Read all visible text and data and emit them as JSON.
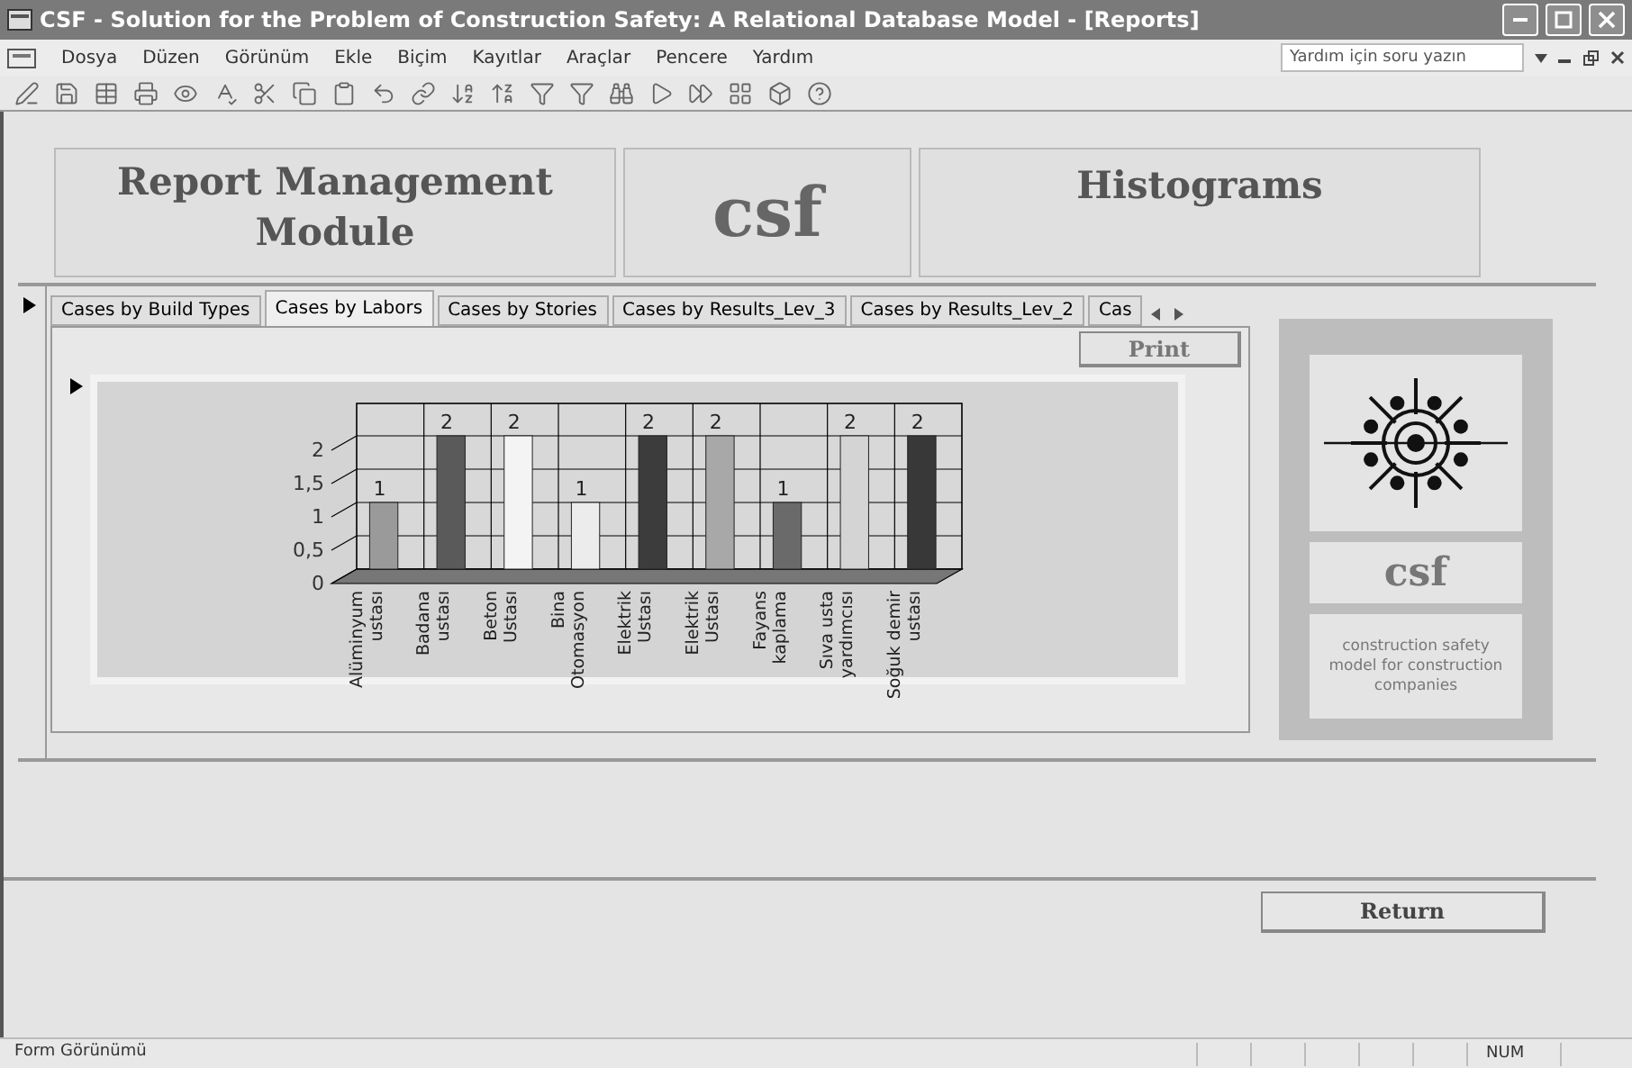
{
  "window": {
    "title": "CSF - Solution for the Problem of Construction Safety: A Relational Database Model - [Reports]"
  },
  "menu": [
    "Dosya",
    "Düzen",
    "Görünüm",
    "Ekle",
    "Biçim",
    "Kayıtlar",
    "Araçlar",
    "Pencere",
    "Yardım"
  ],
  "help_search": {
    "placeholder": "Yardım için soru yazın"
  },
  "header": {
    "module_title": "Report Management Module",
    "logo_text": "csf",
    "section_title": "Histograms"
  },
  "tabs": [
    {
      "label": "Cases by Build Types",
      "selected": false
    },
    {
      "label": "Cases by Labors",
      "selected": true
    },
    {
      "label": "Cases by Stories",
      "selected": false
    },
    {
      "label": "Cases by Results_Lev_3",
      "selected": false
    },
    {
      "label": "Cases by Results_Lev_2",
      "selected": false
    },
    {
      "label": "Cas",
      "selected": false
    }
  ],
  "print_button": "Print",
  "chart": {
    "chart_data": {
      "type": "bar",
      "categories": [
        "Alüminyum ustası",
        "Badana ustası",
        "Beton Ustası",
        "Bina Otomasyon",
        "Elektrik Ustası",
        "Elektrik Ustası",
        "Fayans kaplama",
        "Sıva usta yardımcısı",
        "Soğuk demir ustası"
      ],
      "values": [
        1,
        2,
        2,
        1,
        2,
        2,
        1,
        2,
        2
      ],
      "colors": [
        "#9a9a9a",
        "#5a5a5a",
        "#f4f4f4",
        "#ececec",
        "#3c3c3c",
        "#a8a8a8",
        "#6a6a6a",
        "#d4d4d4",
        "#383838"
      ],
      "ylim": [
        0,
        2
      ],
      "yticks": [
        {
          "value": 0,
          "label": "0"
        },
        {
          "value": 0.5,
          "label": "0,5"
        },
        {
          "value": 1,
          "label": "1"
        },
        {
          "value": 1.5,
          "label": "1,5"
        },
        {
          "value": 2,
          "label": "2"
        }
      ],
      "data_labels": true,
      "grid": true
    }
  },
  "side_panel": {
    "logo_text": "csf",
    "caption": "construction safety model for construction companies"
  },
  "return_button": "Return",
  "status_bar": {
    "mode": "Form Görünümü",
    "indicator": "NUM"
  }
}
